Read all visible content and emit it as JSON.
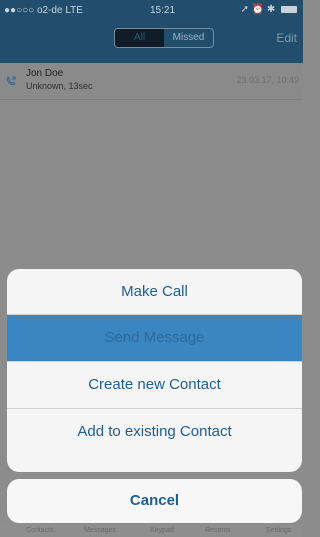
{
  "status": {
    "carrier": "●●○○○ o2-de  LTE",
    "time": "15:21",
    "right_icons": "➚ ⏰ ✱"
  },
  "header": {
    "segments": [
      {
        "label": "All",
        "active": true
      },
      {
        "label": "Missed",
        "active": false
      }
    ],
    "edit_label": "Edit"
  },
  "calls": [
    {
      "name": "Jon Doe",
      "detail": "Unknown, 13sec",
      "date": "23.03.17, 10:49"
    }
  ],
  "action_sheet": {
    "items": [
      {
        "label": "Make Call"
      },
      {
        "label": "Send Message"
      },
      {
        "label": "Create new Contact"
      },
      {
        "label": "Add to existing Contact"
      }
    ],
    "cancel_label": "Cancel"
  },
  "tabbar": {
    "items": [
      "Contacts",
      "Messages",
      "Keypad",
      "Recents",
      "Settings"
    ]
  },
  "colors": {
    "header": "#214e6d",
    "overlay": "#8c8c8c",
    "accent": "#3a86c2",
    "text_blue": "#1c5f96"
  }
}
